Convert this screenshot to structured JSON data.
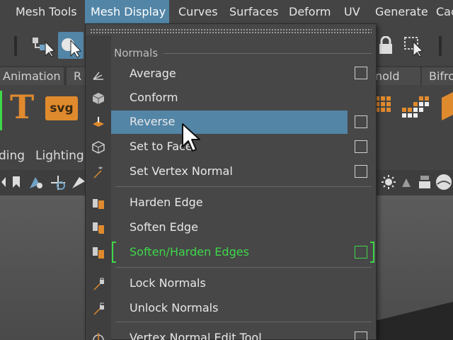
{
  "menubar": {
    "items": [
      {
        "label": "Mesh Tools"
      },
      {
        "label": "Mesh Display"
      },
      {
        "label": "Curves"
      },
      {
        "label": "Surfaces"
      },
      {
        "label": "Deform"
      },
      {
        "label": "UV"
      },
      {
        "label": "Generate"
      },
      {
        "label": "Cac"
      }
    ],
    "active_index": 1
  },
  "shelf_tabs": [
    {
      "label": "Animation"
    },
    {
      "label": "R"
    },
    {
      "label": "nold"
    },
    {
      "label": "Bifro"
    }
  ],
  "shelf": {
    "text_tool_glyph": "T",
    "svg_tool_label": "svg"
  },
  "panel_menus": [
    {
      "label": "ding"
    },
    {
      "label": "Lighting"
    }
  ],
  "dropdown": {
    "section_header": "Normals",
    "entries": [
      {
        "label": "Average",
        "option_box": true,
        "icon": "average-normals-icon"
      },
      {
        "label": "Conform",
        "option_box": false,
        "icon": "conform-normals-icon"
      },
      {
        "label": "Reverse",
        "option_box": true,
        "icon": "reverse-normals-icon",
        "highlighted": true
      },
      {
        "label": "Set to Face",
        "option_box": true,
        "icon": "set-to-face-icon"
      },
      {
        "label": "Set Vertex Normal",
        "option_box": true,
        "icon": "set-vertex-normal-icon"
      },
      {
        "label": "Harden Edge",
        "option_box": false,
        "icon": "harden-edge-icon"
      },
      {
        "label": "Soften Edge",
        "option_box": false,
        "icon": "soften-edge-icon"
      },
      {
        "label": "Soften/Harden Edges",
        "option_box": true,
        "icon": "soften-harden-edges-icon",
        "emphasized": true
      },
      {
        "label": "Lock Normals",
        "option_box": false,
        "icon": "lock-normals-icon"
      },
      {
        "label": "Unlock Normals",
        "option_box": false,
        "icon": "unlock-normals-icon"
      },
      {
        "label": "Vertex Normal Edit Tool",
        "option_box": true,
        "icon": "vertex-normal-edit-tool-icon"
      }
    ]
  },
  "colors": {
    "background": "#444444",
    "menu_panel": "#474747",
    "highlight": "#5285a6",
    "emphasis_green": "#3fd74a",
    "text": "#e8e8e8"
  }
}
